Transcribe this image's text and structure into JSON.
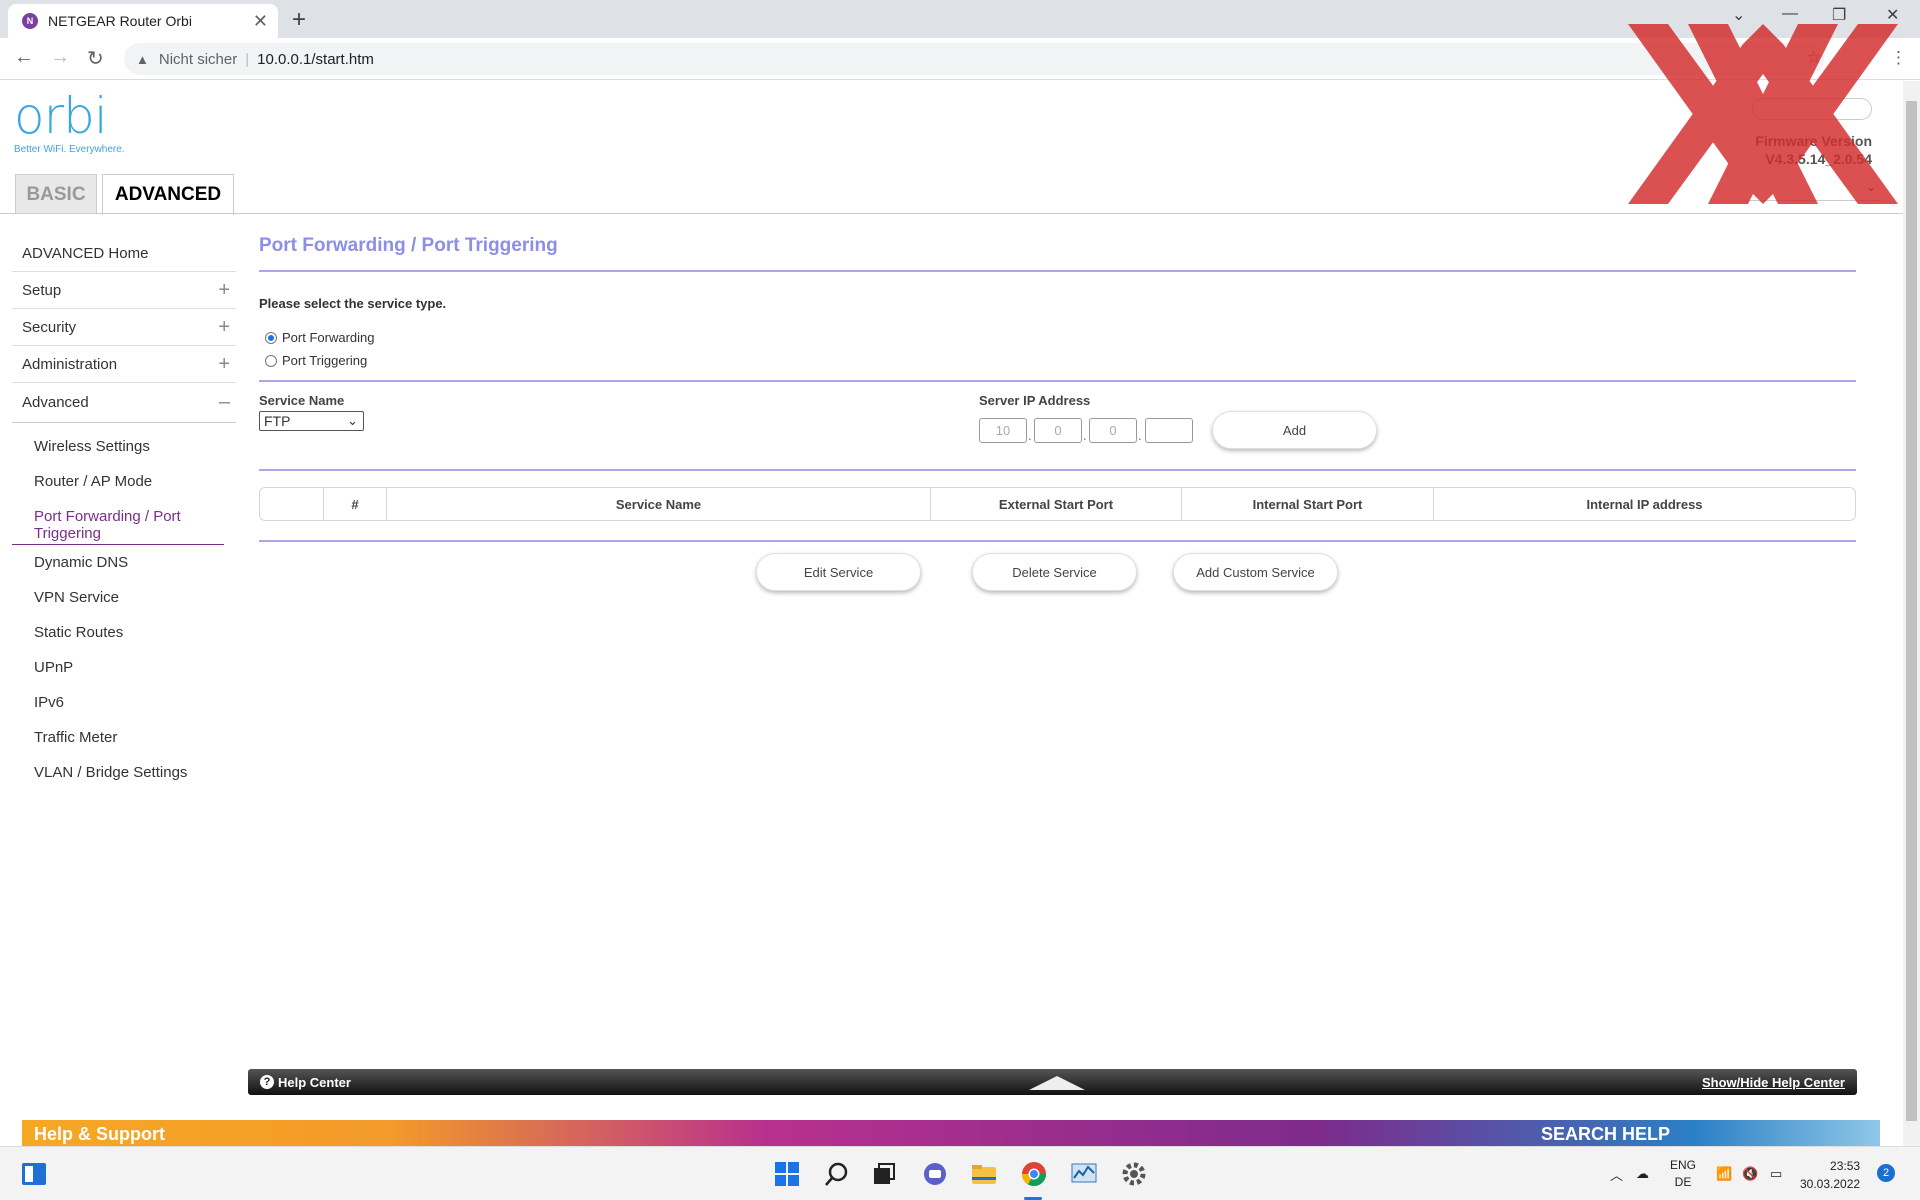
{
  "browser": {
    "tab_title": "NETGEAR Router Orbi",
    "favicon_letter": "N",
    "insecure_label": "Nicht sicher",
    "url": "10.0.0.1/start.htm"
  },
  "header": {
    "logo_text": "orbi",
    "logo_tagline": "Better WiFi. Everywhere.",
    "tab_basic": "BASIC",
    "tab_advanced": "ADVANCED",
    "firmware_label": "Firmware Version",
    "firmware_version": "V4.3.5.14_2.0.54"
  },
  "sidebar": {
    "home": "ADVANCED Home",
    "sections": [
      {
        "label": "Setup",
        "toggle": "+"
      },
      {
        "label": "Security",
        "toggle": "+"
      },
      {
        "label": "Administration",
        "toggle": "+"
      },
      {
        "label": "Advanced",
        "toggle": "–"
      }
    ],
    "sub_items": [
      {
        "label": "Wireless Settings"
      },
      {
        "label": "Router / AP Mode"
      },
      {
        "label": "Port Forwarding / Port Triggering"
      },
      {
        "label": "Dynamic DNS"
      },
      {
        "label": "VPN Service"
      },
      {
        "label": "Static Routes"
      },
      {
        "label": "UPnP"
      },
      {
        "label": "IPv6"
      },
      {
        "label": "Traffic Meter"
      },
      {
        "label": "VLAN / Bridge Settings"
      }
    ]
  },
  "main": {
    "title": "Port Forwarding / Port Triggering",
    "prompt": "Please select the service type.",
    "radio_forwarding": "Port Forwarding",
    "radio_triggering": "Port Triggering",
    "service_name_label": "Service Name",
    "service_name_value": "FTP",
    "server_ip_label": "Server IP Address",
    "ip": [
      "10",
      "0",
      "0",
      ""
    ],
    "add_label": "Add",
    "table_headers": [
      "",
      "#",
      "Service Name",
      "External Start Port",
      "Internal Start Port",
      "Internal IP address"
    ],
    "edit_label": "Edit Service",
    "delete_label": "Delete Service",
    "add_custom_label": "Add Custom Service"
  },
  "help": {
    "title": "Help Center",
    "toggle": "Show/Hide Help Center",
    "support_left": "Help & Support",
    "support_right": "SEARCH HELP"
  },
  "taskbar": {
    "lang_line1": "ENG",
    "lang_line2": "DE",
    "time": "23:53",
    "date": "30.03.2022",
    "notifications": "2"
  },
  "colors": {
    "title_purple": "#8c8ee8",
    "active_purple": "#7b2d8b",
    "orbi_blue": "#3aa7e1"
  }
}
